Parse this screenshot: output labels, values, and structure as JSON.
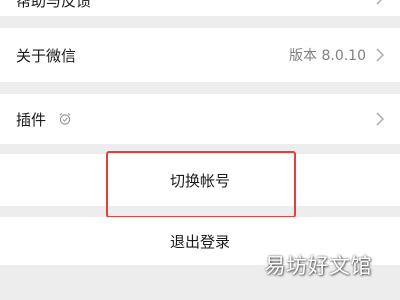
{
  "menu": {
    "help_feedback": "帮助与反馈",
    "about_wechat": "关于微信",
    "version": "版本 8.0.10",
    "plugins": "插件"
  },
  "actions": {
    "switch_account": "切换帐号",
    "logout": "退出登录"
  },
  "watermark": "易坊好文馆",
  "colors": {
    "background": "#ededed",
    "row": "#ffffff",
    "highlight_border": "#e04040",
    "secondary_text": "#808080"
  },
  "icons": {
    "chevron": "chevron-right-icon",
    "plugin": "plugin-alarm-icon"
  }
}
